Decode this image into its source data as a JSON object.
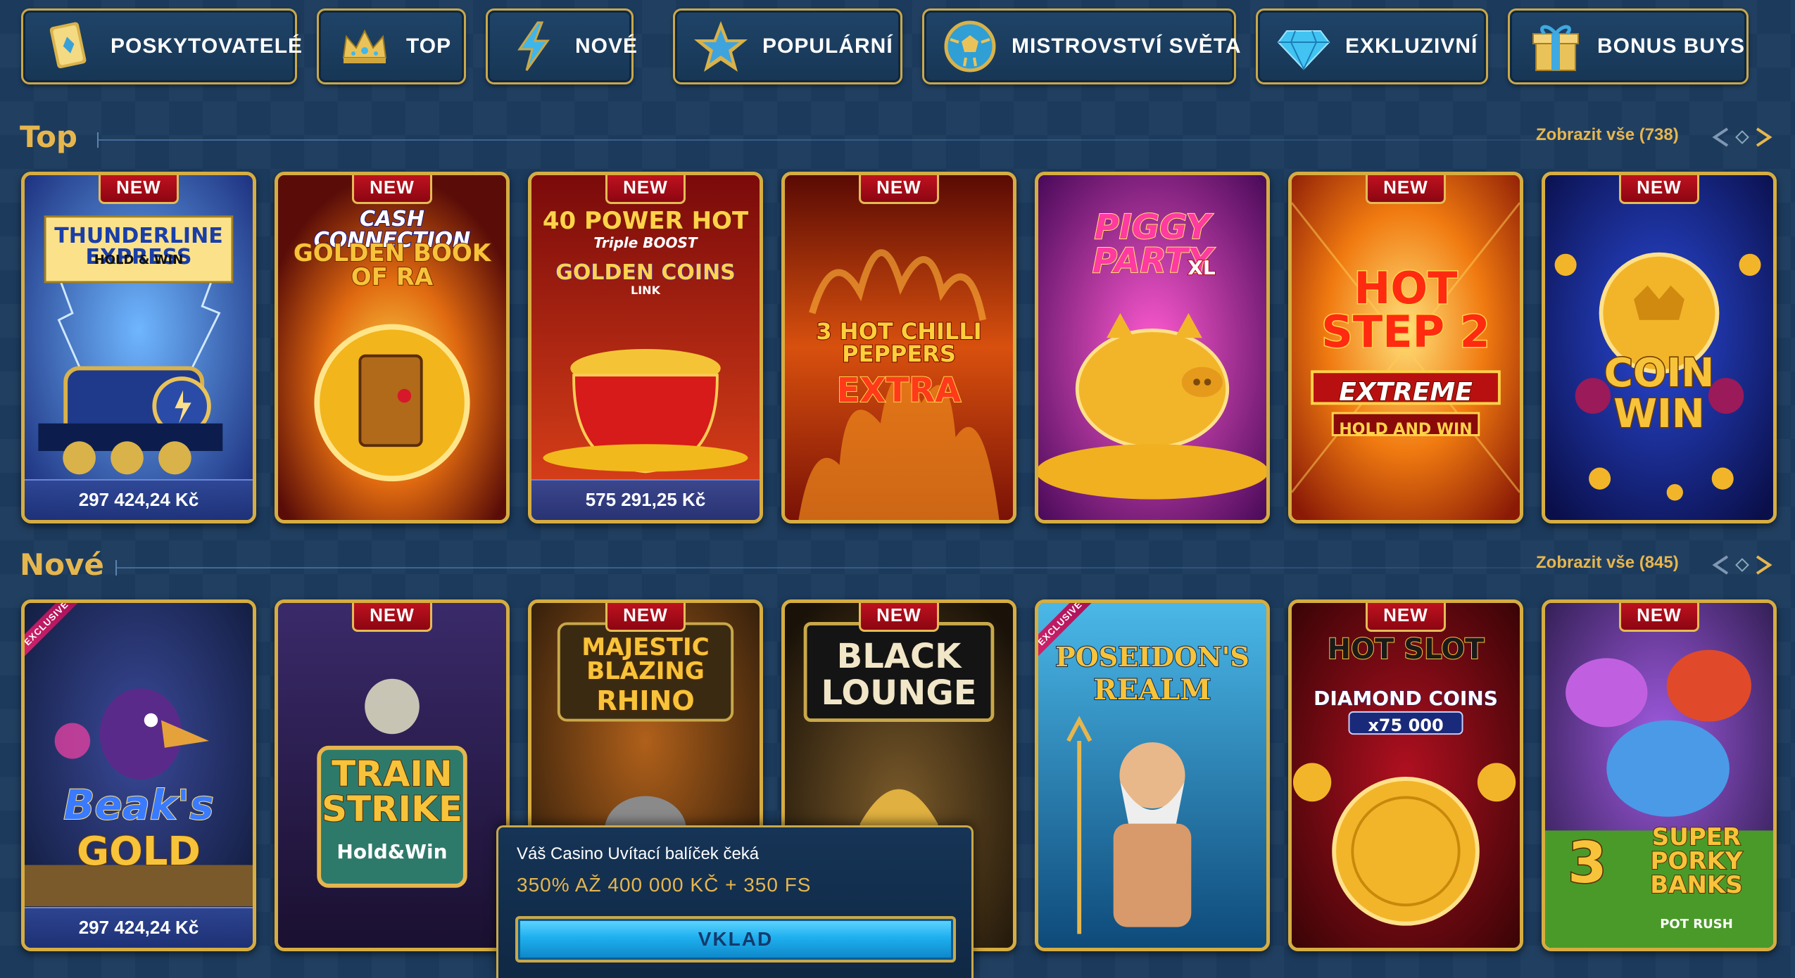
{
  "categories": [
    {
      "label": "POSKYTOVATELÉ",
      "icon": "card-deck-icon"
    },
    {
      "label": "TOP",
      "icon": "crown-icon"
    },
    {
      "label": "NOVÉ",
      "icon": "lightning-icon"
    },
    {
      "label": "POPULÁRNÍ",
      "icon": "star-icon"
    },
    {
      "label": "MISTROVSTVÍ SVĚTA",
      "icon": "soccer-ball-icon"
    },
    {
      "label": "EXKLUZIVNÍ",
      "icon": "diamond-icon"
    },
    {
      "label": "BONUS BUYS",
      "icon": "gift-icon"
    }
  ],
  "sections": {
    "top": {
      "title": "Top",
      "see_all": "Zobrazit vše (738)",
      "games": [
        {
          "name": "THUNDERLINE EXPRESS",
          "subtitle": "HOLD & WIN",
          "badge": "NEW",
          "jackpot": "297 424,24 Kč"
        },
        {
          "name": "CASH CONNECTION",
          "subtitle": "GOLDEN BOOK OF RA",
          "badge": "NEW"
        },
        {
          "name": "40 POWER HOT",
          "subtitle": "GOLDEN COINS",
          "extra": "Triple BOOST",
          "tag": "LINK",
          "badge": "NEW",
          "jackpot": "575 291,25 Kč"
        },
        {
          "name": "3 HOT CHILLI PEPPERS",
          "subtitle": "EXTRA",
          "badge": "NEW"
        },
        {
          "name": "PIGGY PARTY",
          "subtitle": "XL"
        },
        {
          "name": "HOT STEP 2",
          "subtitle": "EXTREME",
          "extra": "HOLD AND WIN",
          "badge": "NEW"
        },
        {
          "name": "COIN",
          "subtitle": "WIN",
          "badge": "NEW"
        }
      ]
    },
    "new": {
      "title": "Nové",
      "see_all": "Zobrazit vše (845)",
      "games": [
        {
          "name": "Beak's",
          "subtitle": "GOLD",
          "badge": "EXCLUSIVE",
          "jackpot": "297 424,24 Kč"
        },
        {
          "name": "TRAIN STRIKE",
          "subtitle": "Hold&Win",
          "badge": "NEW"
        },
        {
          "name": "MAJESTIC BLAZING",
          "subtitle": "RHINO",
          "badge": "NEW"
        },
        {
          "name": "BLACK",
          "subtitle": "LOUNGE",
          "badge": "NEW"
        },
        {
          "name": "POSEIDON'S",
          "subtitle": "REALM",
          "badge": "EXCLUSIVE"
        },
        {
          "name": "HOT SLOT",
          "subtitle": "DIAMOND COINS",
          "extra": "x75 000",
          "badge": "NEW"
        },
        {
          "name": "SUPER PORKY BANKS",
          "subtitle": "POT RUSH",
          "extra": "3",
          "badge": "NEW"
        }
      ]
    }
  },
  "popup": {
    "title": "Váš Casino Uvítací balíček čeká",
    "offer": "350% AŽ 400 000 KČ + 350 FS",
    "button": "VKLAD"
  },
  "colors": {
    "background": "#1c3a5c",
    "gold": "#e6b64e",
    "card_border": "#d6ad41",
    "new_badge": "#c1121f",
    "cta": "#1fb0ef"
  }
}
